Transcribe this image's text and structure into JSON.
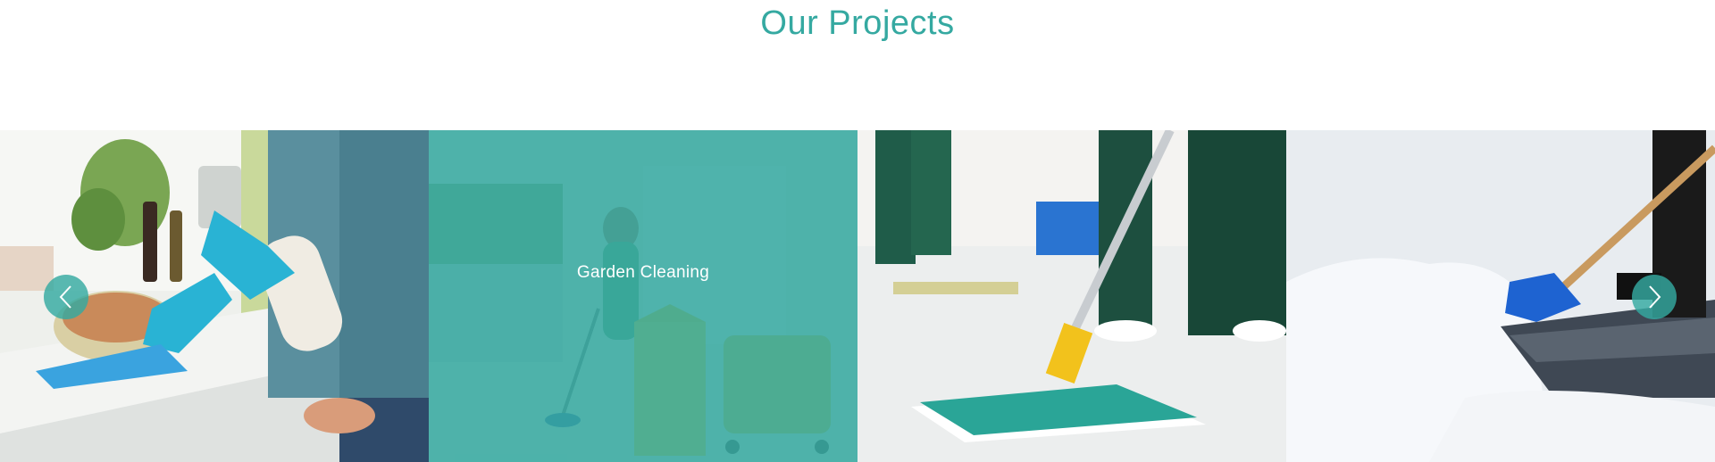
{
  "section": {
    "title": "Our Projects"
  },
  "slider": {
    "slides": [
      {
        "image": "kitchen-counter-cleaning-photo",
        "caption": ""
      },
      {
        "image": "office-floor-mopping-photo",
        "caption": "Garden Cleaning"
      },
      {
        "image": "floor-mop-photo",
        "caption": ""
      },
      {
        "image": "snow-shoveling-photo",
        "caption": ""
      }
    ],
    "prev_icon": "chevron-left-icon",
    "next_icon": "chevron-right-icon"
  },
  "colors": {
    "accent": "#35a9a1",
    "overlay": "rgba(53,169,161,0.86)"
  }
}
